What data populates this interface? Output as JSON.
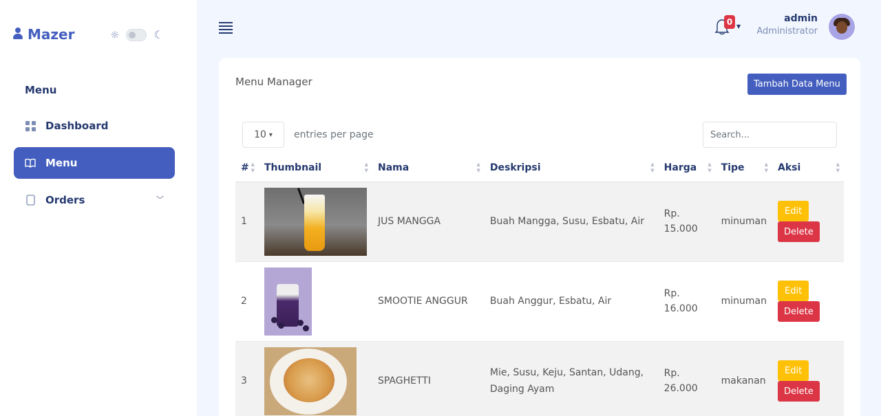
{
  "brand": {
    "name": "Mazer",
    "icon": "person-icon"
  },
  "sidebar": {
    "section_title": "Menu",
    "items": [
      {
        "label": "Dashboard",
        "icon": "grid-icon",
        "active": false
      },
      {
        "label": "Menu",
        "icon": "book-icon",
        "active": true
      },
      {
        "label": "Orders",
        "icon": "document-icon",
        "active": false,
        "expandable": true
      }
    ]
  },
  "header": {
    "notifications_count": "0",
    "user_name": "admin",
    "user_role": "Administrator"
  },
  "card": {
    "title": "Menu Manager",
    "add_button": "Tambah Data Menu",
    "entries_value": "10",
    "entries_label": "entries per page",
    "search_placeholder": "Search..."
  },
  "table": {
    "columns": [
      "#",
      "Thumbnail",
      "Nama",
      "Deskripsi",
      "Harga",
      "Tipe",
      "Aksi"
    ],
    "rows": [
      {
        "no": "1",
        "nama": "JUS MANGGA",
        "deskripsi": "Buah Mangga, Susu, Esbatu, Air",
        "harga_prefix": "Rp.",
        "harga_value": "15.000",
        "tipe": "minuman",
        "edit": "Edit",
        "delete": "Delete"
      },
      {
        "no": "2",
        "nama": "SMOOTIE ANGGUR",
        "deskripsi": "Buah Anggur, Esbatu, Air",
        "harga_prefix": "Rp.",
        "harga_value": "16.000",
        "tipe": "minuman",
        "edit": "Edit",
        "delete": "Delete"
      },
      {
        "no": "3",
        "nama": "SPAGHETTI",
        "deskripsi": "Mie, Susu, Keju, Santan, Udang, Daging Ayam",
        "harga_prefix": "Rp.",
        "harga_value": "26.000",
        "tipe": "makanan",
        "edit": "Edit",
        "delete": "Delete"
      }
    ]
  },
  "colors": {
    "primary": "#435ebe",
    "warning": "#ffc107",
    "danger": "#dc3545",
    "background": "#f2f7ff"
  }
}
